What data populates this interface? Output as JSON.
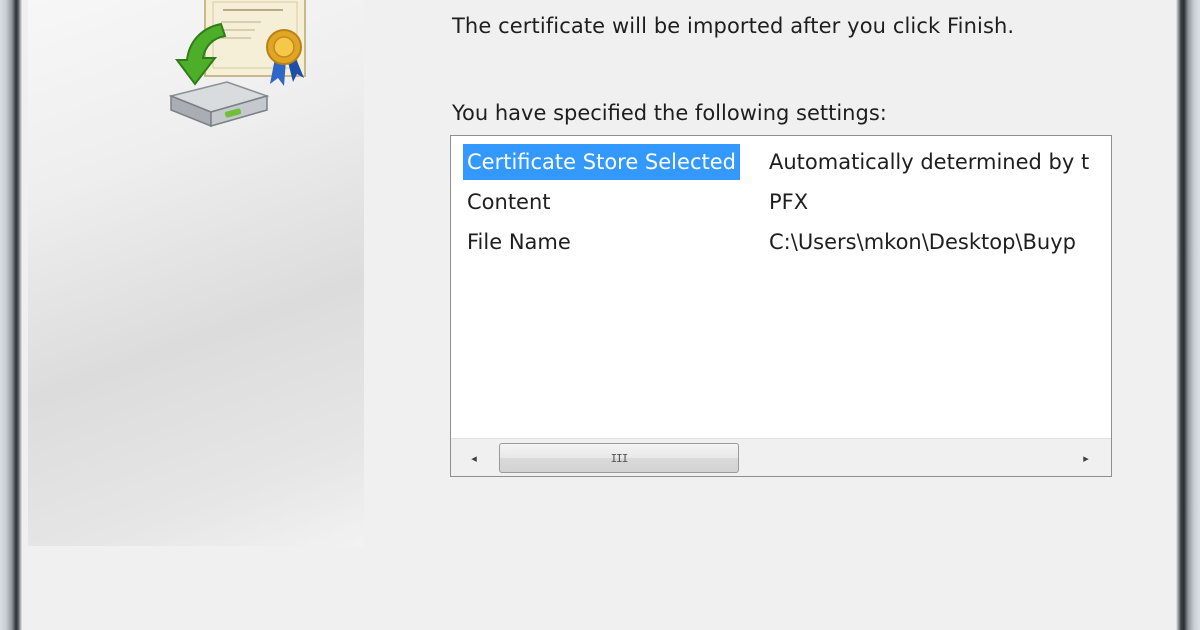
{
  "wizard": {
    "intro": "The certificate will be imported after you click Finish.",
    "settings_label": "You have specified the following settings:",
    "banner_icon": "certificate-import-icon"
  },
  "settings": {
    "rows": [
      {
        "name": "Certificate Store Selected",
        "value": "Automatically determined by t",
        "selected": true
      },
      {
        "name": "Content",
        "value": "PFX",
        "selected": false
      },
      {
        "name": "File Name",
        "value": "C:\\Users\\mkon\\Desktop\\Buyp",
        "selected": false
      }
    ]
  },
  "scrollbar": {
    "left_arrow": "◂",
    "right_arrow": "▸",
    "thumb_grip": "III",
    "position": 0
  },
  "colors": {
    "selection": "#3399ff",
    "background": "#f0f0f0",
    "list_background": "#ffffff"
  }
}
